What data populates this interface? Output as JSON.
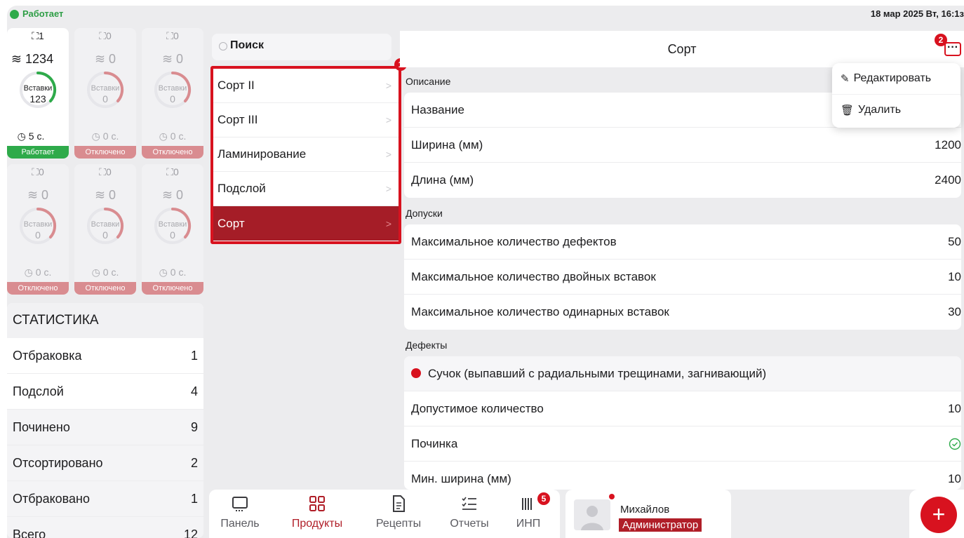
{
  "status": {
    "label": "Работает",
    "datetime": "18 мар 2025 Вт, 16:1з"
  },
  "machines": [
    {
      "counter": "1",
      "layers": "1234",
      "gauge_label": "Вставки",
      "gauge_value": "123",
      "timer": "5 с.",
      "state": "Работает",
      "active": true
    },
    {
      "counter": "0",
      "layers": "0",
      "gauge_label": "Вставки",
      "gauge_value": "0",
      "timer": "0 с.",
      "state": "Отключено",
      "active": false
    },
    {
      "counter": "0",
      "layers": "0",
      "gauge_label": "Вставки",
      "gauge_value": "0",
      "timer": "0 с.",
      "state": "Отключено",
      "active": false
    },
    {
      "counter": "0",
      "layers": "0",
      "gauge_label": "Вставки",
      "gauge_value": "0",
      "timer": "0 с.",
      "state": "Отключено",
      "active": false
    },
    {
      "counter": "0",
      "layers": "0",
      "gauge_label": "Вставки",
      "gauge_value": "0",
      "timer": "0 с.",
      "state": "Отключено",
      "active": false
    },
    {
      "counter": "0",
      "layers": "0",
      "gauge_label": "Вставки",
      "gauge_value": "0",
      "timer": "0 с.",
      "state": "Отключено",
      "active": false
    }
  ],
  "stats": {
    "title": "СТАТИСТИКА",
    "rows": [
      {
        "label": "Отбраковка",
        "value": "1"
      },
      {
        "label": "Подслой",
        "value": "4"
      },
      {
        "label": "Починено",
        "value": "9"
      },
      {
        "label": "Отсортировано",
        "value": "2"
      },
      {
        "label": "Отбраковано",
        "value": "1"
      },
      {
        "label": "Всего",
        "value": "12"
      }
    ]
  },
  "search": {
    "placeholder": "Поиск"
  },
  "products": {
    "badge": "1",
    "items": [
      "Сорт II",
      "Сорт III",
      "Ламинирование",
      "Подслой",
      "Сорт"
    ],
    "selected_index": 4
  },
  "detail": {
    "title": "Сорт",
    "menu_badge": "2",
    "menu_button": "···",
    "menu": {
      "edit": "Редактировать",
      "delete": "Удалить"
    },
    "description_label": "Описание",
    "description": [
      {
        "label": "Название",
        "value": ""
      },
      {
        "label": "Ширина (мм)",
        "value": "1200"
      },
      {
        "label": "Длина (мм)",
        "value": "2400"
      }
    ],
    "tolerances_label": "Допуски",
    "tolerances": [
      {
        "label": "Максимальное количество дефектов",
        "value": "50"
      },
      {
        "label": "Максимальное количество двойных вставок",
        "value": "10"
      },
      {
        "label": "Максимальное количество одинарных вставок",
        "value": "30"
      }
    ],
    "defects_label": "Дефекты",
    "defect_name": "Сучок (выпавший с радиальными трещинами, загнивающий)",
    "defect_rows": [
      {
        "label": "Допустимое количество",
        "value": "10"
      },
      {
        "label": "Починка",
        "value": ""
      },
      {
        "label": "Мин. ширина (мм)",
        "value": "10"
      }
    ]
  },
  "nav": {
    "tabs": [
      {
        "label": "Панель",
        "icon": "monitor-icon"
      },
      {
        "label": "Продукты",
        "icon": "grid-icon"
      },
      {
        "label": "Рецепты",
        "icon": "document-icon"
      },
      {
        "label": "Отчеты",
        "icon": "checklist-icon"
      },
      {
        "label": "ИНП",
        "icon": "barcode-icon"
      }
    ],
    "active_index": 1,
    "inp_badge": "5"
  },
  "user": {
    "name": "Михайлов",
    "role": "Администратор"
  },
  "fab": {
    "label": "+"
  },
  "colors": {
    "accent": "#d8121f",
    "selected": "#a51d27",
    "ok": "#2eaa4a",
    "off": "#d98c90"
  }
}
